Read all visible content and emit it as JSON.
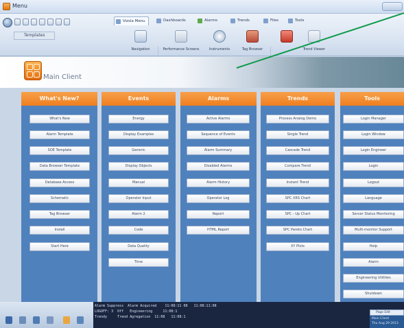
{
  "window": {
    "title": "Menu"
  },
  "toolbar": {
    "user_field": "Templates"
  },
  "tabs": [
    "Vizsla Menu",
    "Dashboards",
    "Alarms",
    "Trends",
    "Files",
    "Tools"
  ],
  "ribbon": {
    "buttons": [
      "Navigation",
      "Performance Screens",
      "Instruments",
      "Tag Browser",
      "Trend Viewer"
    ]
  },
  "header": {
    "title": "Main Client"
  },
  "columns": [
    {
      "title": "What's New?",
      "items": [
        "What's New",
        "Alarm Template",
        "SOE Template",
        "Data Browser Template",
        "Database Access",
        "Schematic",
        "Tag Browser",
        "Install",
        "Start Here"
      ]
    },
    {
      "title": "Events",
      "items": [
        "Energy",
        "Display Examples",
        "Generic",
        "Display Objects",
        "Manual",
        "Operator Input",
        "Alarm 2",
        "Code",
        "Data Quality",
        "Time"
      ]
    },
    {
      "title": "Alarms",
      "items": [
        "Active Alarms",
        "Sequence of Events",
        "Alarm Summary",
        "Disabled Alarms",
        "Alarm History",
        "Operator Log",
        "Report",
        "HTML Report"
      ]
    },
    {
      "title": "Trends",
      "items": [
        "Process Analog Demo",
        "Single Trend",
        "Cascade Trend",
        "Compare Trend",
        "Instant Trend",
        "SPC XRS Chart",
        "SPC - Up Chart",
        "SPC Pareto Chart",
        "XY Plots"
      ]
    },
    {
      "title": "Tools",
      "items": [
        "Login Manager",
        "Login Window",
        "Login Engineer",
        "Login",
        "Logout",
        "Language",
        "Server Status Monitoring",
        "Multi-monitor Support",
        "Help",
        "Alarm",
        "Engineering Utilities",
        "Shutdown"
      ]
    }
  ],
  "status_log": [
    "Alarm Suppress  Alarm Acquired    11:08:11 08   11:08:11:08",
    "LOGOFF: 3  Off   Engineering     11:08:1",
    "Trendy     Trend Agregation  11:08   11:08:1"
  ],
  "mini_panel": {
    "title": "Page Edit",
    "lines": [
      "Main Client",
      "Thu Aug 29 2013"
    ]
  },
  "colors": {
    "column_header": "#ef7f1f",
    "column_body": "#4f81bd",
    "status_bar": "#1a2640",
    "annotation_line": "#0f9a4a"
  },
  "icons": {
    "app": "app-icon",
    "logo": "grid-logo-icon",
    "ribbon": [
      "navigation-icon",
      "performance-screens-icon",
      "instruments-icon",
      "tag-browser-icon",
      "trend-viewer-icon"
    ]
  }
}
